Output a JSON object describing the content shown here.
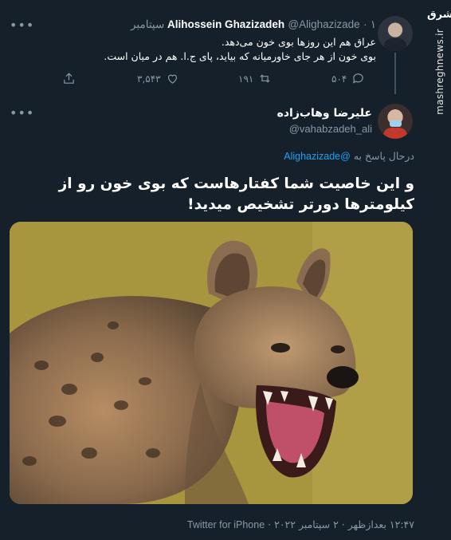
{
  "watermark": {
    "logo": "مشرق",
    "site": "mashreghnews.ir"
  },
  "parent_tweet": {
    "name": "Alihossein Ghazizadeh",
    "handle": "@Alighazizade",
    "separator": "·",
    "date": "۱ سپتامبر",
    "body_line1": "عراق هم این روزها بوی خون می‌دهد.",
    "body_line2": "بوی خون از هر جای خاورمیانه که بیاید، پای ج.ا. هم در میان است.",
    "replies": "۵۰۴",
    "retweets": "۱۹۱",
    "likes": "۳,۵۴۳",
    "more": "•••"
  },
  "reply_tweet": {
    "name": "علیرضا وهاب‌زاده",
    "handle": "@vahabzadeh_ali",
    "replying_prefix": "درحال پاسخ به",
    "replying_to": "@Alighazizade",
    "body": "و این خاصیت شما کفتارهاست که بوی خون رو از کیلومترها دورتر تشخیص میدید!",
    "time_date": "۱۲:۴۷ بعدازظهر · ۲ سپتامبر ۲۰۲۲",
    "source_sep": "·",
    "source": "Twitter for iPhone",
    "more": "•••"
  },
  "colors": {
    "background": "#15202b",
    "accent": "#1da1f2",
    "muted": "#8899a6"
  },
  "icons": [
    "reply-icon",
    "retweet-icon",
    "like-icon",
    "share-icon",
    "more-icon"
  ]
}
